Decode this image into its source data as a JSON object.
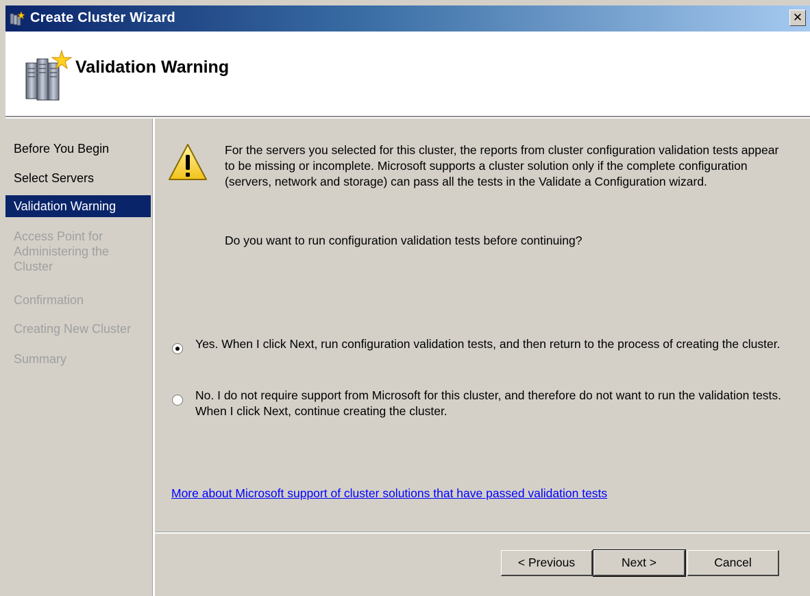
{
  "window": {
    "title": "Create Cluster Wizard",
    "close_label": "✕",
    "title_icon": "cluster-wizard-icon",
    "close_icon": "close-icon"
  },
  "header": {
    "title": "Validation Warning",
    "icon": "cluster-server-icon"
  },
  "sidebar": {
    "steps": [
      {
        "label": "Before You Begin",
        "state": "normal"
      },
      {
        "label": "Select Servers",
        "state": "normal"
      },
      {
        "label": "Validation Warning",
        "state": "active"
      },
      {
        "label": "Access Point for\nAdministering the\nCluster",
        "state": "disabled"
      },
      {
        "label": "Confirmation",
        "state": "disabled"
      },
      {
        "label": "Creating New Cluster",
        "state": "disabled"
      },
      {
        "label": "Summary",
        "state": "disabled"
      }
    ]
  },
  "main": {
    "warning_icon": "warning-icon",
    "message": "For the servers you selected for this cluster, the reports from cluster configuration validation tests appear to be missing or incomplete.  Microsoft supports a cluster solution only if the complete configuration (servers, network and storage) can pass all the tests in the Validate a Configuration wizard.",
    "question": "Do you want to run configuration validation tests before continuing?",
    "options": [
      {
        "label": "Yes.  When I click Next, run configuration validation tests, and then return to the process of creating the cluster.",
        "selected": true
      },
      {
        "label": "No.  I do not require support from Microsoft for this cluster, and therefore do not want to run the validation tests.  When I click Next, continue creating the cluster.",
        "selected": false
      }
    ],
    "link": "More about Microsoft support of cluster solutions that have passed validation tests"
  },
  "buttons": {
    "previous": "< Previous",
    "next": "Next >",
    "cancel": "Cancel"
  },
  "colors": {
    "titlebar": "#0a246a",
    "active_step": "#0a246a",
    "face": "#d4d0c8",
    "link": "#0000ff",
    "disabled_text": "#a0a0a0"
  }
}
